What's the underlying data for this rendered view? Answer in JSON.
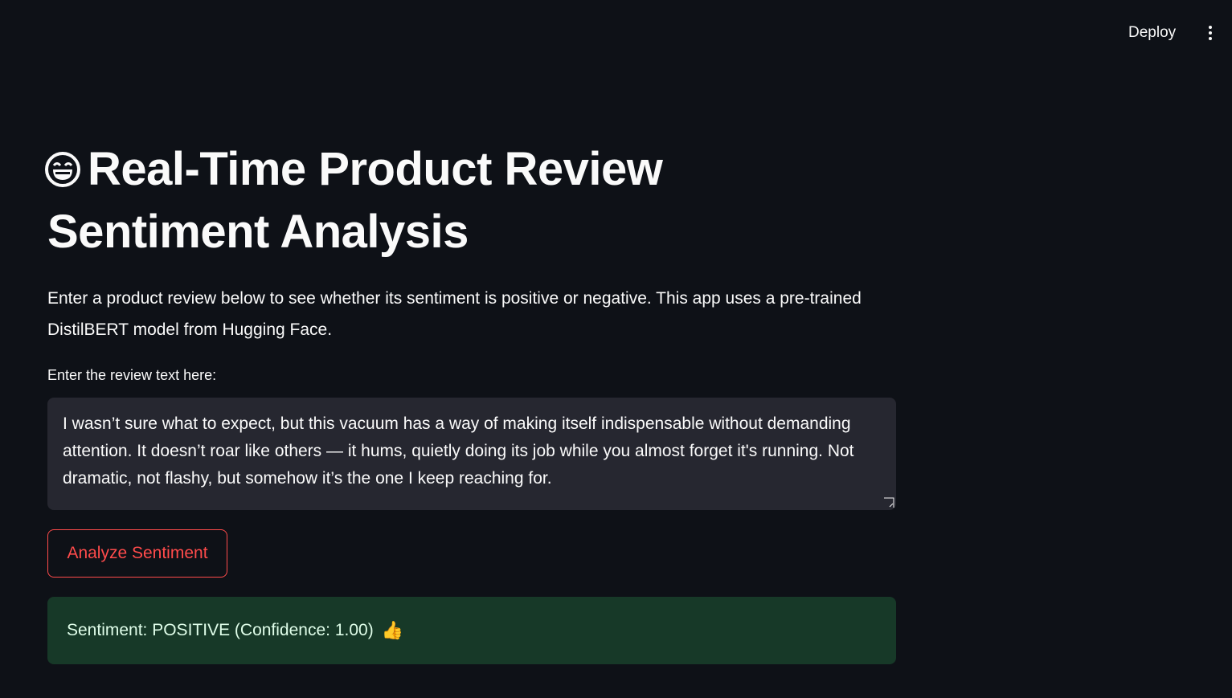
{
  "header": {
    "deploy_label": "Deploy",
    "menu_icon": "kebab-menu-icon"
  },
  "page": {
    "title_icon": "grinning-face-icon",
    "title": "Real-Time Product Review Sentiment Analysis",
    "description": "Enter a product review below to see whether its sentiment is positive or negative. This app uses a pre-trained DistilBERT model from Hugging Face."
  },
  "review_input": {
    "label": "Enter the review text here:",
    "value": "I wasn’t sure what to expect, but this vacuum has a way of making itself indispensable without demanding attention. It doesn’t roar like others — it hums, quietly doing its job while you almost forget it's running. Not dramatic, not flashy, but somehow it’s the one I keep reaching for."
  },
  "analyze_button": {
    "label": "Analyze Sentiment"
  },
  "result": {
    "text": "Sentiment: POSITIVE (Confidence: 1.00)",
    "icon": "👍"
  },
  "colors": {
    "background": "#0e1117",
    "input_bg": "#262730",
    "accent": "#ff4b4b",
    "success_bg": "#173928"
  }
}
